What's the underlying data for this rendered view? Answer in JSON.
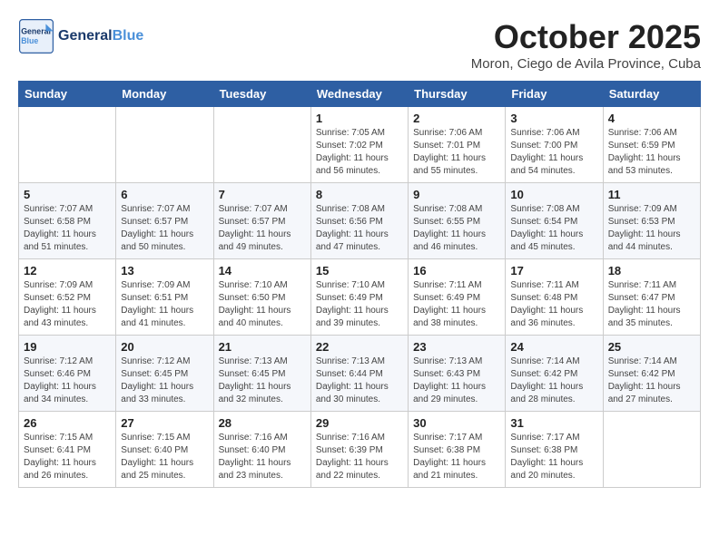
{
  "logo": {
    "general": "General",
    "blue": "Blue"
  },
  "title": "October 2025",
  "subtitle": "Moron, Ciego de Avila Province, Cuba",
  "days_of_week": [
    "Sunday",
    "Monday",
    "Tuesday",
    "Wednesday",
    "Thursday",
    "Friday",
    "Saturday"
  ],
  "weeks": [
    [
      {
        "day": "",
        "info": ""
      },
      {
        "day": "",
        "info": ""
      },
      {
        "day": "",
        "info": ""
      },
      {
        "day": "1",
        "info": "Sunrise: 7:05 AM\nSunset: 7:02 PM\nDaylight: 11 hours\nand 56 minutes."
      },
      {
        "day": "2",
        "info": "Sunrise: 7:06 AM\nSunset: 7:01 PM\nDaylight: 11 hours\nand 55 minutes."
      },
      {
        "day": "3",
        "info": "Sunrise: 7:06 AM\nSunset: 7:00 PM\nDaylight: 11 hours\nand 54 minutes."
      },
      {
        "day": "4",
        "info": "Sunrise: 7:06 AM\nSunset: 6:59 PM\nDaylight: 11 hours\nand 53 minutes."
      }
    ],
    [
      {
        "day": "5",
        "info": "Sunrise: 7:07 AM\nSunset: 6:58 PM\nDaylight: 11 hours\nand 51 minutes."
      },
      {
        "day": "6",
        "info": "Sunrise: 7:07 AM\nSunset: 6:57 PM\nDaylight: 11 hours\nand 50 minutes."
      },
      {
        "day": "7",
        "info": "Sunrise: 7:07 AM\nSunset: 6:57 PM\nDaylight: 11 hours\nand 49 minutes."
      },
      {
        "day": "8",
        "info": "Sunrise: 7:08 AM\nSunset: 6:56 PM\nDaylight: 11 hours\nand 47 minutes."
      },
      {
        "day": "9",
        "info": "Sunrise: 7:08 AM\nSunset: 6:55 PM\nDaylight: 11 hours\nand 46 minutes."
      },
      {
        "day": "10",
        "info": "Sunrise: 7:08 AM\nSunset: 6:54 PM\nDaylight: 11 hours\nand 45 minutes."
      },
      {
        "day": "11",
        "info": "Sunrise: 7:09 AM\nSunset: 6:53 PM\nDaylight: 11 hours\nand 44 minutes."
      }
    ],
    [
      {
        "day": "12",
        "info": "Sunrise: 7:09 AM\nSunset: 6:52 PM\nDaylight: 11 hours\nand 43 minutes."
      },
      {
        "day": "13",
        "info": "Sunrise: 7:09 AM\nSunset: 6:51 PM\nDaylight: 11 hours\nand 41 minutes."
      },
      {
        "day": "14",
        "info": "Sunrise: 7:10 AM\nSunset: 6:50 PM\nDaylight: 11 hours\nand 40 minutes."
      },
      {
        "day": "15",
        "info": "Sunrise: 7:10 AM\nSunset: 6:49 PM\nDaylight: 11 hours\nand 39 minutes."
      },
      {
        "day": "16",
        "info": "Sunrise: 7:11 AM\nSunset: 6:49 PM\nDaylight: 11 hours\nand 38 minutes."
      },
      {
        "day": "17",
        "info": "Sunrise: 7:11 AM\nSunset: 6:48 PM\nDaylight: 11 hours\nand 36 minutes."
      },
      {
        "day": "18",
        "info": "Sunrise: 7:11 AM\nSunset: 6:47 PM\nDaylight: 11 hours\nand 35 minutes."
      }
    ],
    [
      {
        "day": "19",
        "info": "Sunrise: 7:12 AM\nSunset: 6:46 PM\nDaylight: 11 hours\nand 34 minutes."
      },
      {
        "day": "20",
        "info": "Sunrise: 7:12 AM\nSunset: 6:45 PM\nDaylight: 11 hours\nand 33 minutes."
      },
      {
        "day": "21",
        "info": "Sunrise: 7:13 AM\nSunset: 6:45 PM\nDaylight: 11 hours\nand 32 minutes."
      },
      {
        "day": "22",
        "info": "Sunrise: 7:13 AM\nSunset: 6:44 PM\nDaylight: 11 hours\nand 30 minutes."
      },
      {
        "day": "23",
        "info": "Sunrise: 7:13 AM\nSunset: 6:43 PM\nDaylight: 11 hours\nand 29 minutes."
      },
      {
        "day": "24",
        "info": "Sunrise: 7:14 AM\nSunset: 6:42 PM\nDaylight: 11 hours\nand 28 minutes."
      },
      {
        "day": "25",
        "info": "Sunrise: 7:14 AM\nSunset: 6:42 PM\nDaylight: 11 hours\nand 27 minutes."
      }
    ],
    [
      {
        "day": "26",
        "info": "Sunrise: 7:15 AM\nSunset: 6:41 PM\nDaylight: 11 hours\nand 26 minutes."
      },
      {
        "day": "27",
        "info": "Sunrise: 7:15 AM\nSunset: 6:40 PM\nDaylight: 11 hours\nand 25 minutes."
      },
      {
        "day": "28",
        "info": "Sunrise: 7:16 AM\nSunset: 6:40 PM\nDaylight: 11 hours\nand 23 minutes."
      },
      {
        "day": "29",
        "info": "Sunrise: 7:16 AM\nSunset: 6:39 PM\nDaylight: 11 hours\nand 22 minutes."
      },
      {
        "day": "30",
        "info": "Sunrise: 7:17 AM\nSunset: 6:38 PM\nDaylight: 11 hours\nand 21 minutes."
      },
      {
        "day": "31",
        "info": "Sunrise: 7:17 AM\nSunset: 6:38 PM\nDaylight: 11 hours\nand 20 minutes."
      },
      {
        "day": "",
        "info": ""
      }
    ]
  ]
}
